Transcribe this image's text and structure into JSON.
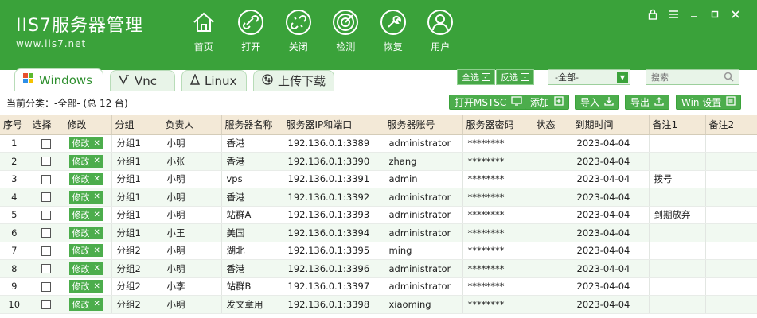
{
  "app": {
    "logo_title": "IIS7服务器管理",
    "logo_url": "www.iis7.net"
  },
  "nav": [
    {
      "label": "首页",
      "icon": "home-icon"
    },
    {
      "label": "打开",
      "icon": "link-icon"
    },
    {
      "label": "关闭",
      "icon": "unlink-icon"
    },
    {
      "label": "检测",
      "icon": "radar-icon"
    },
    {
      "label": "恢复",
      "icon": "wrench-icon"
    },
    {
      "label": "用户",
      "icon": "user-icon"
    }
  ],
  "window_controls": {
    "lock": "lock-icon",
    "menu": "menu-icon",
    "minimize": "minimize-icon",
    "maximize": "maximize-icon",
    "close": "close-icon"
  },
  "tabs": [
    {
      "label": "Windows",
      "icon": "windows-icon"
    },
    {
      "label": "Vnc",
      "icon": "vnc-icon"
    },
    {
      "label": "Linux",
      "icon": "linux-icon"
    },
    {
      "label": "上传下载",
      "icon": "upload-download-icon"
    }
  ],
  "toolbar": {
    "select_all": "全选",
    "invert_select": "反选",
    "group_value": "-全部-",
    "search_placeholder": "搜索"
  },
  "subbar": {
    "category": "当前分类：-全部- (总 12 台)",
    "open_mstsc": "打开MSTSC",
    "add": "添加",
    "import": "导入",
    "export": "导出",
    "win_settings": "Win 设置"
  },
  "table": {
    "columns": [
      "序号",
      "选择",
      "修改",
      "分组",
      "负责人",
      "服务器名称",
      "服务器IP和端口",
      "服务器账号",
      "服务器密码",
      "状态",
      "到期时间",
      "备注1",
      "备注2"
    ],
    "edit_label": "修改",
    "rows": [
      {
        "idx": "1",
        "group": "分组1",
        "owner": "小明",
        "name": "香港",
        "ip": "192.136.0.1:3389",
        "account": "administrator",
        "pwd": "********",
        "status": "",
        "expire": "2023-04-04",
        "note1": "",
        "note2": ""
      },
      {
        "idx": "2",
        "group": "分组1",
        "owner": "小张",
        "name": "香港",
        "ip": "192.136.0.1:3390",
        "account": "zhang",
        "pwd": "********",
        "status": "",
        "expire": "2023-04-04",
        "note1": "",
        "note2": ""
      },
      {
        "idx": "3",
        "group": "分组1",
        "owner": "小明",
        "name": "vps",
        "ip": "192.136.0.1:3391",
        "account": "admin",
        "pwd": "********",
        "status": "",
        "expire": "2023-04-04",
        "note1": "拨号",
        "note2": ""
      },
      {
        "idx": "4",
        "group": "分组1",
        "owner": "小明",
        "name": "香港",
        "ip": "192.136.0.1:3392",
        "account": "administrator",
        "pwd": "********",
        "status": "",
        "expire": "2023-04-04",
        "note1": "",
        "note2": ""
      },
      {
        "idx": "5",
        "group": "分组1",
        "owner": "小明",
        "name": "站群A",
        "ip": "192.136.0.1:3393",
        "account": "administrator",
        "pwd": "********",
        "status": "",
        "expire": "2023-04-04",
        "note1": "到期放弃",
        "note2": ""
      },
      {
        "idx": "6",
        "group": "分组1",
        "owner": "小王",
        "name": "美国",
        "ip": "192.136.0.1:3394",
        "account": "administrator",
        "pwd": "********",
        "status": "",
        "expire": "2023-04-04",
        "note1": "",
        "note2": ""
      },
      {
        "idx": "7",
        "group": "分组2",
        "owner": "小明",
        "name": "湖北",
        "ip": "192.136.0.1:3395",
        "account": "ming",
        "pwd": "********",
        "status": "",
        "expire": "2023-04-04",
        "note1": "",
        "note2": ""
      },
      {
        "idx": "8",
        "group": "分组2",
        "owner": "小明",
        "name": "香港",
        "ip": "192.136.0.1:3396",
        "account": "administrator",
        "pwd": "********",
        "status": "",
        "expire": "2023-04-04",
        "note1": "",
        "note2": ""
      },
      {
        "idx": "9",
        "group": "分组2",
        "owner": "小李",
        "name": "站群B",
        "ip": "192.136.0.1:3397",
        "account": "administrator",
        "pwd": "********",
        "status": "",
        "expire": "2023-04-04",
        "note1": "",
        "note2": ""
      },
      {
        "idx": "10",
        "group": "分组2",
        "owner": "小明",
        "name": "发文章用",
        "ip": "192.136.0.1:3398",
        "account": "xiaoming",
        "pwd": "********",
        "status": "",
        "expire": "2023-04-04",
        "note1": "",
        "note2": ""
      }
    ]
  },
  "colors": {
    "brand_green": "#3aa23a",
    "header_row": "#f3e9d7",
    "alt_row": "#f1f9f1"
  }
}
